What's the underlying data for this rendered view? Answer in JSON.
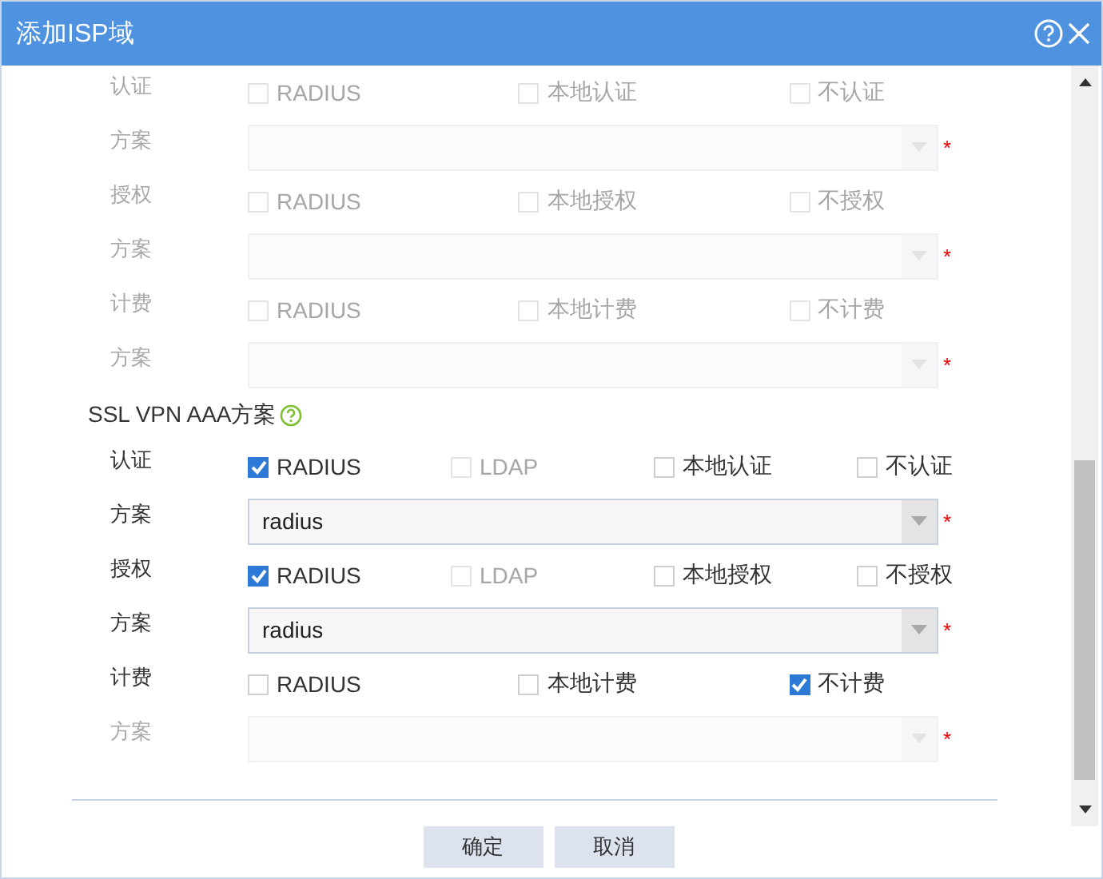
{
  "window": {
    "title": "添加ISP域"
  },
  "sections": [
    {
      "rows": [
        {
          "kind": "checks",
          "label": "认证",
          "disabled": true,
          "options": [
            {
              "label": "RADIUS",
              "checked": false,
              "disabled": true
            },
            {
              "label": "本地认证",
              "checked": false,
              "disabled": true
            },
            {
              "label": "不认证",
              "checked": false,
              "disabled": true
            }
          ]
        },
        {
          "kind": "select",
          "label": "方案",
          "disabled": true,
          "required_mark": "*"
        },
        {
          "kind": "checks",
          "label": "授权",
          "disabled": true,
          "options": [
            {
              "label": "RADIUS",
              "checked": false,
              "disabled": true
            },
            {
              "label": "本地授权",
              "checked": false,
              "disabled": true
            },
            {
              "label": "不授权",
              "checked": false,
              "disabled": true
            }
          ]
        },
        {
          "kind": "select",
          "label": "方案",
          "disabled": true,
          "required_mark": "*"
        },
        {
          "kind": "checks",
          "label": "计费",
          "disabled": true,
          "options": [
            {
              "label": "RADIUS",
              "checked": false,
              "disabled": true
            },
            {
              "label": "本地计费",
              "checked": false,
              "disabled": true
            },
            {
              "label": "不计费",
              "checked": false,
              "disabled": true
            }
          ]
        },
        {
          "kind": "select",
          "label": "方案",
          "disabled": true,
          "required_mark": "*"
        }
      ]
    },
    {
      "heading": "SSL VPN AAA方案",
      "rows": [
        {
          "kind": "checks",
          "label": "认证",
          "disabled": false,
          "options": [
            {
              "label": "RADIUS",
              "checked": true,
              "disabled": false
            },
            {
              "label": "LDAP",
              "checked": false,
              "disabled": true
            },
            {
              "label": "本地认证",
              "checked": false,
              "disabled": false
            },
            {
              "label": "不认证",
              "checked": false,
              "disabled": false
            }
          ]
        },
        {
          "kind": "select",
          "label": "方案",
          "value": "radius",
          "disabled": false,
          "required_mark": "*"
        },
        {
          "kind": "checks",
          "label": "授权",
          "disabled": false,
          "options": [
            {
              "label": "RADIUS",
              "checked": true,
              "disabled": false
            },
            {
              "label": "LDAP",
              "checked": false,
              "disabled": true
            },
            {
              "label": "本地授权",
              "checked": false,
              "disabled": false
            },
            {
              "label": "不授权",
              "checked": false,
              "disabled": false
            }
          ]
        },
        {
          "kind": "select",
          "label": "方案",
          "value": "radius",
          "disabled": false,
          "required_mark": "*"
        },
        {
          "kind": "checks",
          "label": "计费",
          "disabled": false,
          "options": [
            {
              "label": "RADIUS",
              "checked": false,
              "disabled": false
            },
            {
              "label": "本地计费",
              "checked": false,
              "disabled": false
            },
            {
              "label": "不计费",
              "checked": true,
              "disabled": false
            }
          ]
        },
        {
          "kind": "select",
          "label": "方案",
          "disabled": true,
          "required_mark": "*"
        }
      ]
    }
  ],
  "buttons": [
    {
      "label": "确定"
    },
    {
      "label": "取消"
    }
  ]
}
